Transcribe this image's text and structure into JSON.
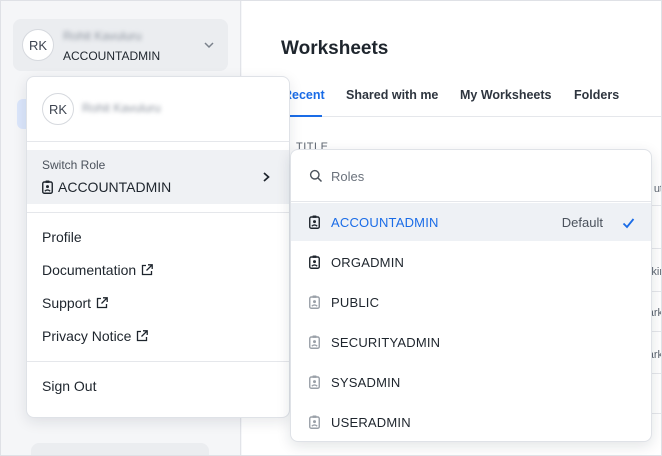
{
  "user": {
    "initials": "RK",
    "name": "Rohit Kavuluru",
    "current_role": "ACCOUNTADMIN"
  },
  "main": {
    "title": "Worksheets",
    "tabs": [
      {
        "label": "Recent",
        "active": true
      },
      {
        "label": "Shared with me",
        "active": false
      },
      {
        "label": "My Worksheets",
        "active": false
      },
      {
        "label": "Folders",
        "active": false
      }
    ],
    "column_header": "TITLE",
    "row_fragments": [
      "ut",
      "kir",
      "ark",
      "ark"
    ]
  },
  "user_menu": {
    "switch_role_label": "Switch Role",
    "switch_role_value": "ACCOUNTADMIN",
    "items": [
      {
        "label": "Profile",
        "external": false
      },
      {
        "label": "Documentation",
        "external": true
      },
      {
        "label": "Support",
        "external": true
      },
      {
        "label": "Privacy Notice",
        "external": true
      }
    ],
    "sign_out": "Sign Out"
  },
  "roles_menu": {
    "search_placeholder": "Roles",
    "default_label": "Default",
    "roles": [
      {
        "name": "ACCOUNTADMIN",
        "selected": true,
        "default": true,
        "icon": "role-badge-icon"
      },
      {
        "name": "ORGADMIN",
        "selected": false,
        "default": false,
        "icon": "role-badge-icon"
      },
      {
        "name": "PUBLIC",
        "selected": false,
        "default": false,
        "icon": "role-badge-icon"
      },
      {
        "name": "SECURITYADMIN",
        "selected": false,
        "default": false,
        "icon": "role-badge-icon"
      },
      {
        "name": "SYSADMIN",
        "selected": false,
        "default": false,
        "icon": "role-badge-icon"
      },
      {
        "name": "USERADMIN",
        "selected": false,
        "default": false,
        "icon": "role-badge-icon"
      }
    ]
  },
  "colors": {
    "accent": "#1a6ce7",
    "selected_row": "#eef1f5",
    "switch_row": "#eff1f4"
  }
}
